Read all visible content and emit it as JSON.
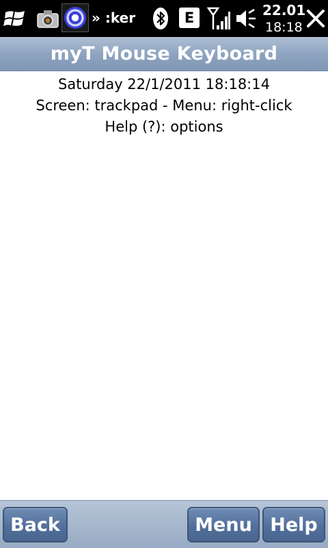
{
  "status_bar": {
    "overflow_label": "» :ker",
    "network_label": "E",
    "clock_line1": "22.01",
    "clock_line2": "18:18",
    "icons": [
      "windows-logo",
      "camera",
      "app-disc",
      "bluetooth",
      "signal",
      "volume",
      "close"
    ]
  },
  "title_bar": {
    "title": "myT Mouse Keyboard"
  },
  "content": {
    "datetime": "Saturday 22/1/2011 18:18:14",
    "screen_info": "Screen: trackpad - Menu: right-click",
    "help_info": "Help (?): options"
  },
  "softkeys": {
    "back": "Back",
    "menu": "Menu",
    "help": "Help"
  },
  "colors": {
    "title_bar": "#8ea4c0",
    "softkey": "#52709b",
    "status_bar": "#000000"
  }
}
